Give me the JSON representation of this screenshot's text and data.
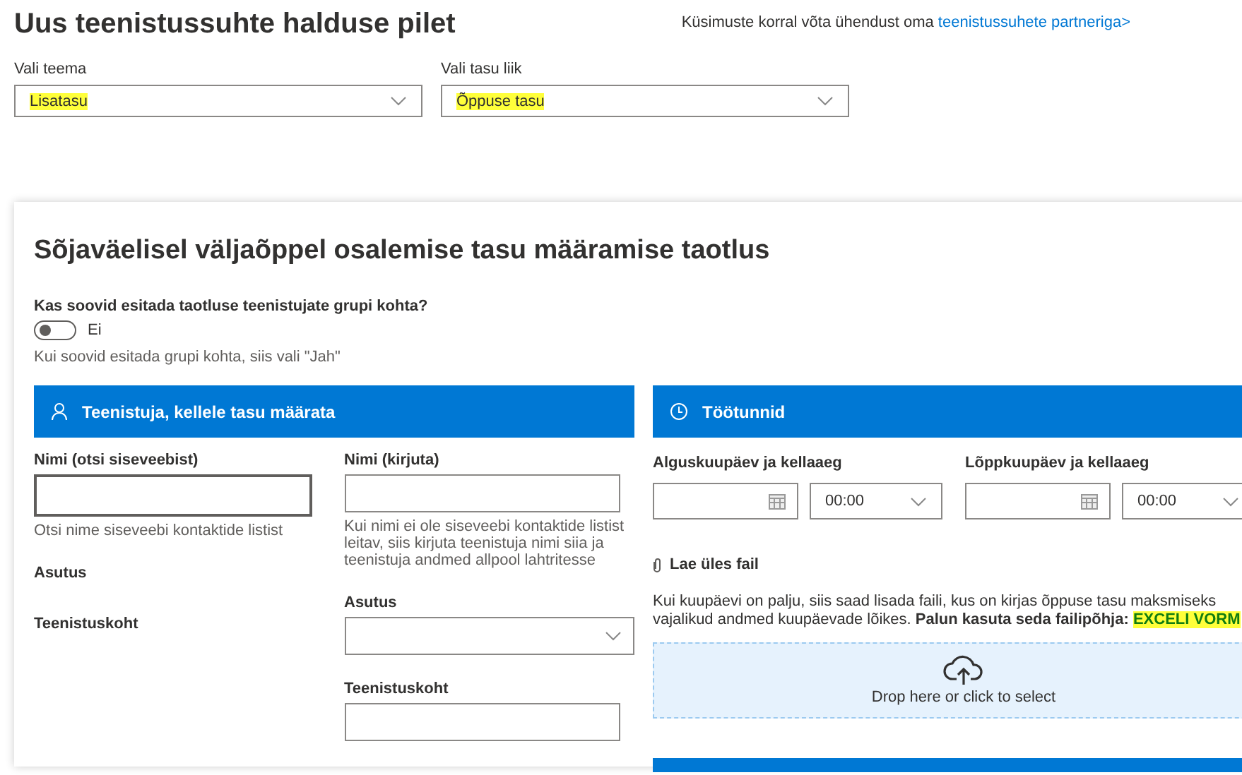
{
  "page_title": "Uus teenistussuhte halduse pilet",
  "contact": {
    "text": "Küsimuste korral võta ühendust oma",
    "link": "teenistussuhete partneriga>"
  },
  "selects": [
    {
      "label": "Vali teema",
      "value": "Lisatasu",
      "highlighted": true
    },
    {
      "label": "Vali tasu liik",
      "value": "Õppuse tasu",
      "highlighted": true
    }
  ],
  "form": {
    "title": "Sõjaväelisel väljaõppel osalemise tasu määramise taotlus",
    "group_question": "Kas soovid esitada taotluse teenistujate grupi kohta?",
    "group_toggle": {
      "on": false,
      "label": "Ei"
    },
    "group_hint": "Kui soovid esitada grupi kohta, siis vali \"Jah\"",
    "employee_section": {
      "title": "Teenistuja, kellele tasu määrata",
      "left": [
        {
          "kind": "field",
          "label": "Nimi (otsi siseveebist)",
          "hint": "Otsi nime siseveebi kontaktide listist"
        },
        {
          "kind": "static",
          "label": "Asutus"
        },
        {
          "kind": "static",
          "label": "Teenistuskoht"
        }
      ],
      "right": [
        {
          "kind": "field",
          "label": "Nimi (kirjuta)",
          "hint": "Kui nimi ei ole siseveebi kontaktide listist leitav, siis kirjuta teenistuja nimi siia ja teenistuja andmed allpool lahtritesse"
        },
        {
          "kind": "dropdown",
          "label": "Asutus"
        },
        {
          "kind": "field",
          "label": "Teenistuskoht"
        }
      ]
    },
    "hours_section": {
      "title": "Töötunnid",
      "ranges": [
        {
          "label": "Alguskuupäev ja kellaaeg",
          "time": "00:00"
        },
        {
          "label": "Lõppkuupäev ja kellaaeg",
          "time": "00:00"
        }
      ],
      "upload_label": "Lae üles fail",
      "upload_note": "Kui kuupäevi on palju, siis saad lisada faili, kus on kirjas õppuse tasu maksmiseks vajalikud andmed kuupäevade lõikes. **Palun kasuta seda failipõhja:**",
      "template_link": {
        "text": "EXCELI VORM",
        "highlighted": true
      },
      "dropzone": "Drop here or click to select"
    }
  }
}
